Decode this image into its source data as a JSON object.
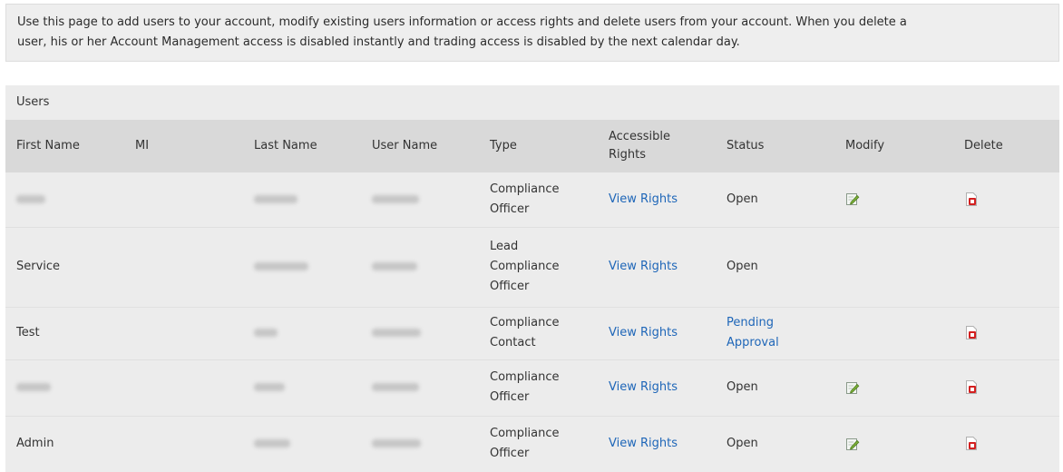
{
  "notice": {
    "line1": "Use this page to add users to your account, modify existing users information or access rights and delete users from your account. When you delete a",
    "line2": "user, his or her Account Management access is disabled instantly and trading access is disabled by the next calendar day."
  },
  "users": {
    "title": "Users",
    "columns": {
      "first_name": "First Name",
      "mi": "MI",
      "last_name": "Last Name",
      "user_name": "User Name",
      "type": "Type",
      "rights_line1": "Accessible",
      "rights_line2": "Rights",
      "status": "Status",
      "modify": "Modify",
      "delete": "Delete"
    },
    "rows": [
      {
        "first_name": "",
        "type_lines": [
          "Compliance",
          "Officer"
        ],
        "rights": "View Rights",
        "status_lines": [
          "Open"
        ],
        "status_is_link": false,
        "can_modify": true,
        "can_delete": true
      },
      {
        "first_name": "Service",
        "type_lines": [
          "Lead",
          "Compliance",
          "Officer"
        ],
        "rights": "View Rights",
        "status_lines": [
          "Open"
        ],
        "status_is_link": false,
        "can_modify": false,
        "can_delete": false
      },
      {
        "first_name": "Test",
        "type_lines": [
          "Compliance",
          "Contact"
        ],
        "rights": "View Rights",
        "status_lines": [
          "Pending",
          "Approval"
        ],
        "status_is_link": true,
        "can_modify": false,
        "can_delete": true
      },
      {
        "first_name": "",
        "type_lines": [
          "Compliance",
          "Officer"
        ],
        "rights": "View Rights",
        "status_lines": [
          "Open"
        ],
        "status_is_link": false,
        "can_modify": true,
        "can_delete": true
      },
      {
        "first_name": "Admin",
        "type_lines": [
          "Compliance",
          "Officer"
        ],
        "rights": "View Rights",
        "status_lines": [
          "Open"
        ],
        "status_is_link": false,
        "can_modify": true,
        "can_delete": true
      }
    ]
  },
  "colors": {
    "link": "#1e66b8",
    "header_bg": "#d9d9d9",
    "row_bg": "#ececec"
  },
  "icons": {
    "modify": "pencil-icon",
    "delete": "delete-icon"
  }
}
